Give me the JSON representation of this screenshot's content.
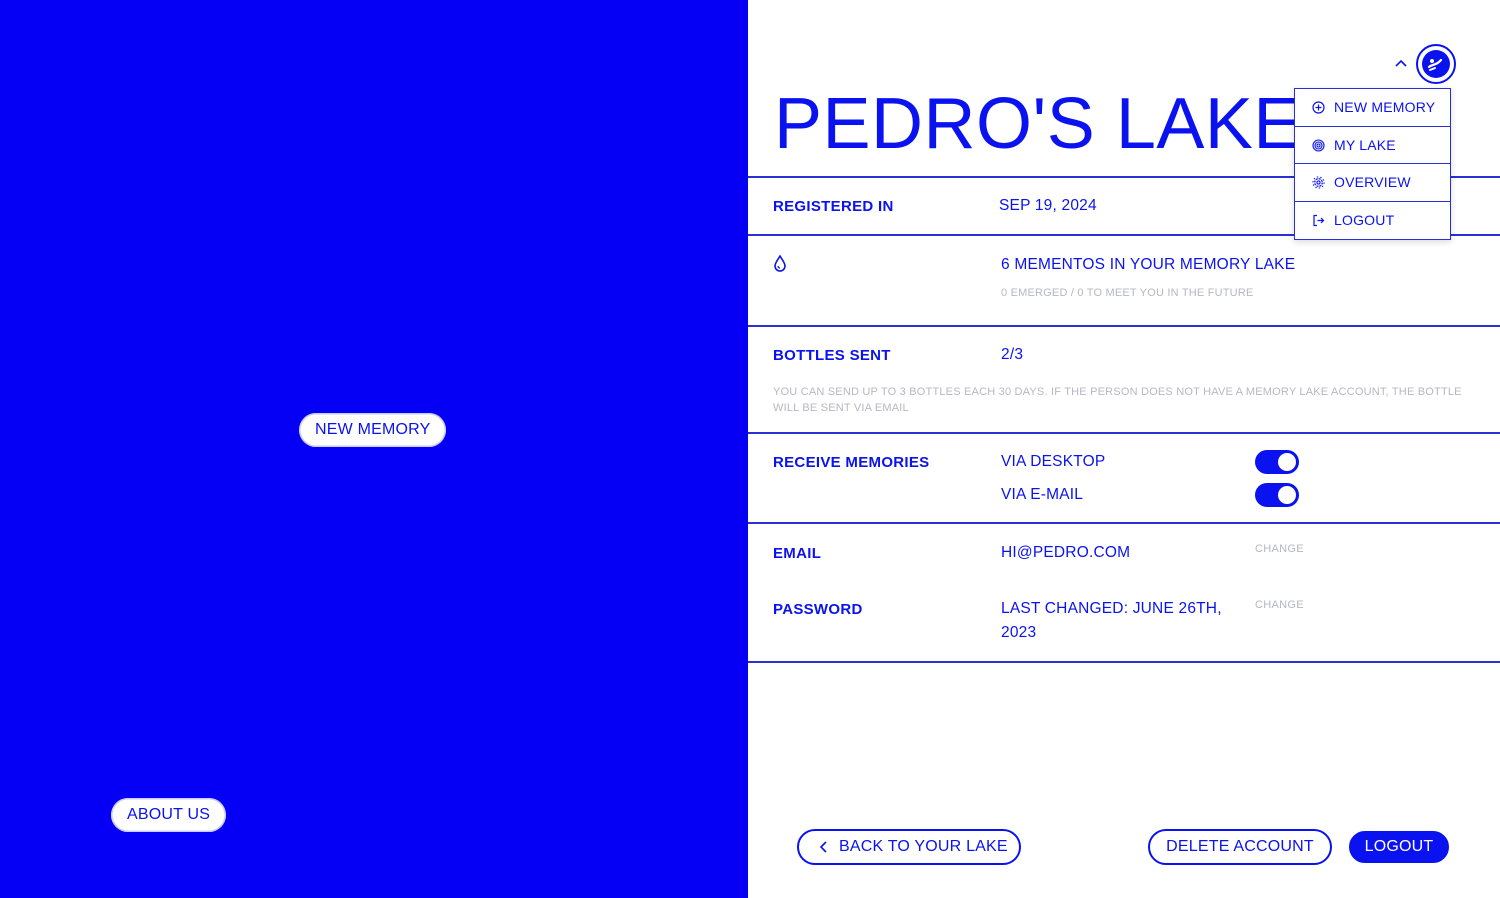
{
  "left_panel": {
    "new_memory_label": "NEW MEMORY",
    "about_label": "ABOUT US"
  },
  "header": {
    "title": "PEDRO'S LAKE"
  },
  "menu": {
    "items": [
      {
        "label": "NEW MEMORY",
        "icon": "plus-circle-icon"
      },
      {
        "label": "MY LAKE",
        "icon": "spiral-icon"
      },
      {
        "label": "OVERVIEW",
        "icon": "gear-icon"
      },
      {
        "label": "LOGOUT",
        "icon": "logout-icon"
      }
    ]
  },
  "registered": {
    "label": "REGISTERED IN",
    "value": "SEP 19, 2024"
  },
  "mementos": {
    "icon": "drop-icon",
    "value": "6 MEMENTOS IN YOUR MEMORY LAKE",
    "note": "0 EMERGED / 0 TO MEET YOU IN THE FUTURE"
  },
  "bottles": {
    "label": "BOTTLES SENT",
    "value": "2/3",
    "note": "YOU CAN SEND UP TO 3 BOTTLES EACH 30 DAYS. IF THE PERSON DOES NOT HAVE A MEMORY LAKE ACCOUNT, THE BOTTLE WILL BE SENT VIA EMAIL"
  },
  "receive": {
    "label": "RECEIVE MEMORIES",
    "desktop_label": "VIA DESKTOP",
    "desktop_on": true,
    "email_label": "VIA E-MAIL",
    "email_on": true
  },
  "email": {
    "label": "EMAIL",
    "value": "HI@PEDRO.COM",
    "change": "CHANGE"
  },
  "password": {
    "label": "PASSWORD",
    "value_line1": "LAST CHANGED: JUNE 26TH,",
    "value_line2": "2023",
    "change": "CHANGE"
  },
  "footer": {
    "back_label": "BACK TO YOUR LAKE",
    "delete_label": "DELETE ACCOUNT",
    "logout_label": "LOGOUT"
  },
  "colors": {
    "brand_blue": "#0500f5",
    "text_blue": "#0a12f0",
    "muted": "#b7b7c4"
  }
}
